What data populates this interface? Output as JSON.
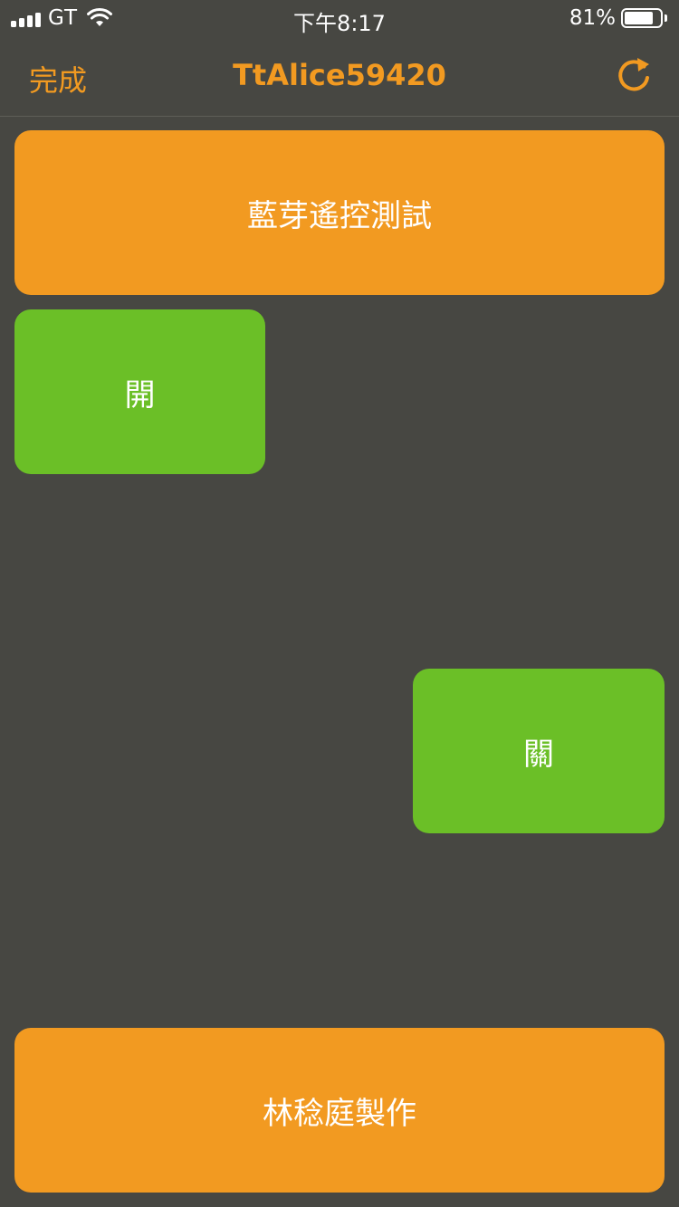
{
  "status_bar": {
    "carrier": "GT",
    "time": "下午8:17",
    "battery_percent": "81%",
    "battery_level": 0.81,
    "signal_bars": 4,
    "icons": [
      "signal-icon",
      "wifi-icon",
      "battery-icon"
    ]
  },
  "nav": {
    "done_label": "完成",
    "title": "TtAlice59420",
    "refresh_icon": "refresh-icon"
  },
  "buttons": {
    "title_button": "藍芽遙控測試",
    "on_button": "開",
    "off_button": "關",
    "credit_button": "林稔庭製作"
  },
  "colors": {
    "background": "#474742",
    "accent_orange": "#f29a21",
    "green": "#6bbf27",
    "text": "#ffffff"
  }
}
